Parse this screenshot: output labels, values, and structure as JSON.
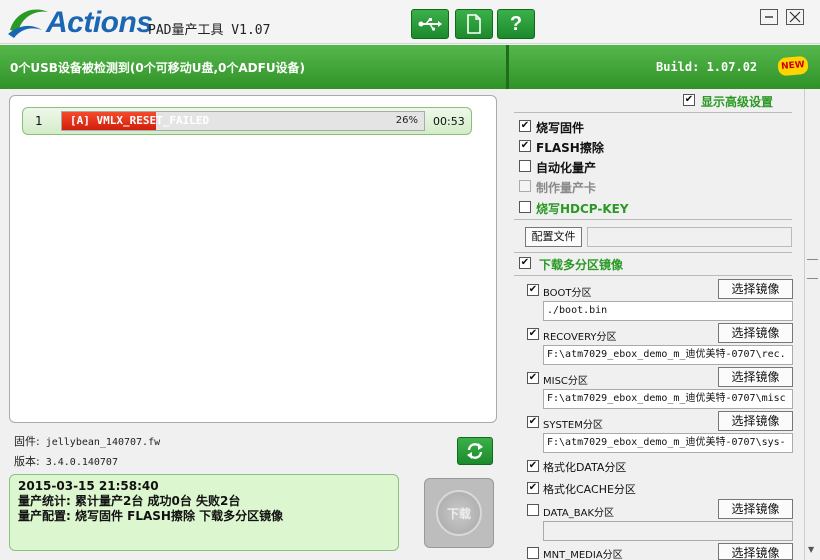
{
  "app": {
    "brand": "Actions",
    "title": "PAD量产工具 V1.07"
  },
  "status": {
    "detected": "0个USB设备被检测到(0个可移动U盘,0个ADFU设备)",
    "build": "Build: 1.07.02",
    "new_badge": "NEW"
  },
  "device": {
    "index": "1",
    "label": "[A] VMLX_RESET_FAILED",
    "progress": 26,
    "progress_text": "26%",
    "time": "00:53"
  },
  "firmware": {
    "label": "固件:",
    "value": "jellybean_140707.fw",
    "version_label": "版本:",
    "version_value": "3.4.0.140707"
  },
  "log": {
    "line1": "2015-03-15 21:58:40",
    "line2": "量产统计: 累计量产2台 成功0台 失败2台",
    "line3": "量产配置: 烧写固件 FLASH擦除 下载多分区镜像"
  },
  "download_label": "下载",
  "settings": {
    "advanced": "显示高级设置",
    "burn_fw": "烧写固件",
    "flash_erase": "FLASH擦除",
    "auto_prod": "自动化量产",
    "make_card": "制作量产卡",
    "burn_hdcp": "烧写HDCP-KEY",
    "config_file": "配置文件",
    "multi_part": "下载多分区镜像",
    "select_image": "选择镜像",
    "partitions": [
      {
        "label": "BOOT分区",
        "path": "./boot.bin"
      },
      {
        "label": "RECOVERY分区",
        "path": "F:\\atm7029_ebox_demo_m_迪优美特-0707\\rec."
      },
      {
        "label": "MISC分区",
        "path": "F:\\atm7029_ebox_demo_m_迪优美特-0707\\misc"
      },
      {
        "label": "SYSTEM分区",
        "path": "F:\\atm7029_ebox_demo_m_迪优美特-0707\\sys-"
      }
    ],
    "format_data": "格式化DATA分区",
    "format_cache": "格式化CACHE分区",
    "data_bak": "DATA_BAK分区",
    "mnt_media": "MNT_MEDIA分区"
  },
  "colors": {
    "accent_green": "#2f9227",
    "brand_blue": "#1a66b3",
    "error_red": "#d01f0c"
  }
}
